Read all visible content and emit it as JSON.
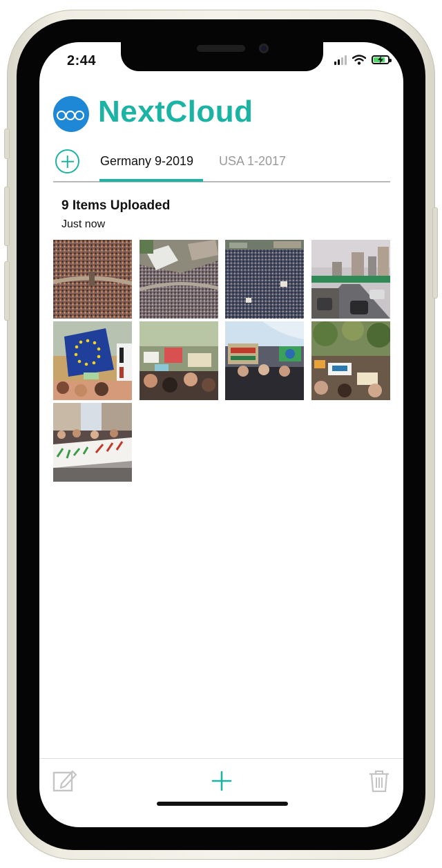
{
  "status_bar": {
    "time": "2:44",
    "icons": [
      "signal-icon",
      "wifi-icon",
      "battery-charging-icon"
    ]
  },
  "app": {
    "title": "NextCloud",
    "logo_icon": "nextcloud-logo-icon"
  },
  "tabs": {
    "add_icon": "plus-circle-icon",
    "items": [
      {
        "label": "Germany 9-2019",
        "active": true
      },
      {
        "label": "USA 1-2017",
        "active": false
      }
    ]
  },
  "upload": {
    "title": "9 Items Uploaded",
    "time": "Just now"
  },
  "photos": [
    {
      "subject": "crowd-aerial-square"
    },
    {
      "subject": "crowd-aerial-building"
    },
    {
      "subject": "crowd-street-dense"
    },
    {
      "subject": "city-street-traffic"
    },
    {
      "subject": "eu-flag-protest-signs"
    },
    {
      "subject": "protest-signs-crowd"
    },
    {
      "subject": "protest-welt-signs"
    },
    {
      "subject": "protest-trees-signs"
    },
    {
      "subject": "protest-klima-banner"
    }
  ],
  "toolbar": {
    "edit_icon": "compose-icon",
    "add_icon": "plus-icon",
    "delete_icon": "trash-icon"
  },
  "colors": {
    "accent": "#1bb3a4",
    "logo_blue": "#1e88d6",
    "text": "#111111",
    "muted": "#999999"
  }
}
